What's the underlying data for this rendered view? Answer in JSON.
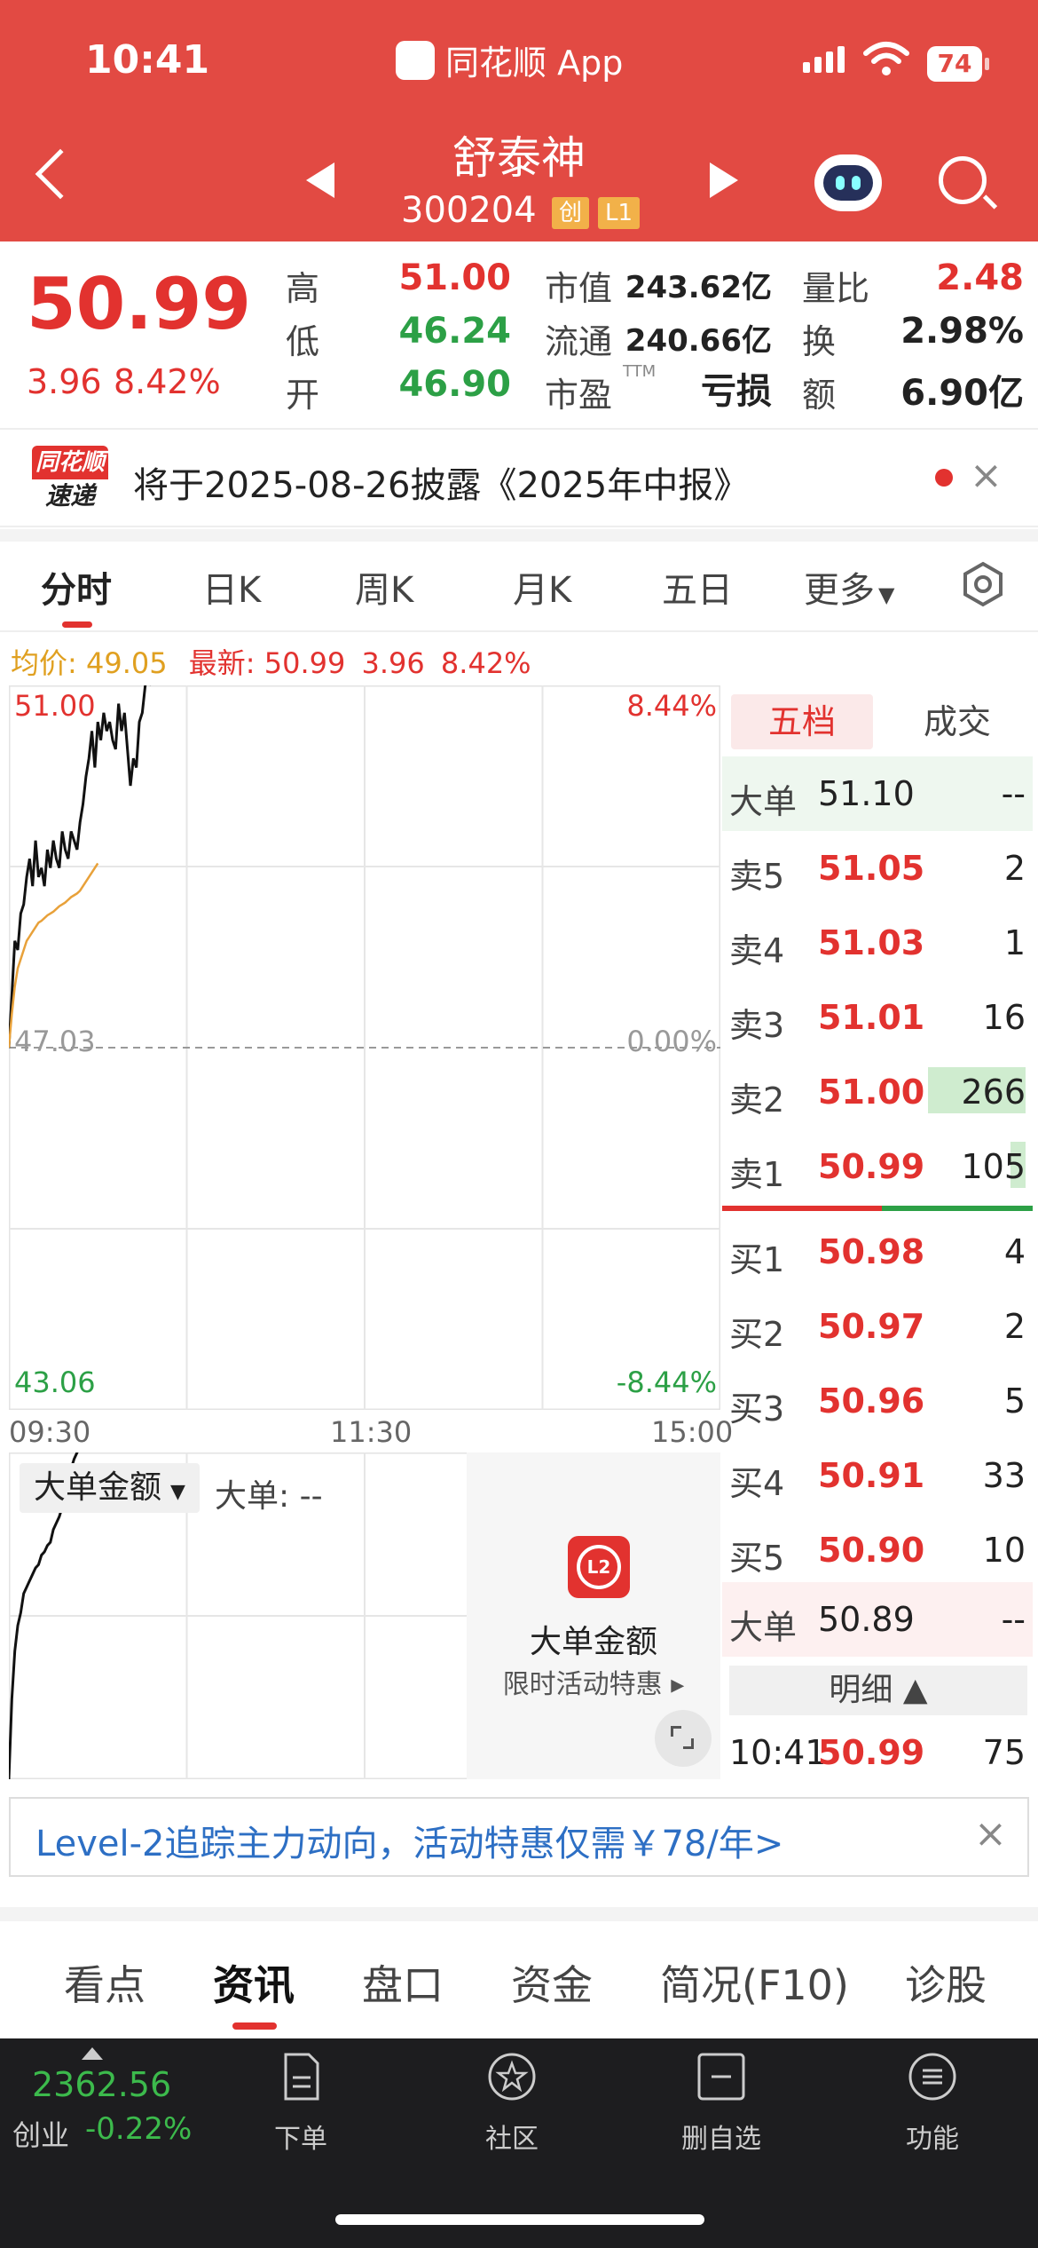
{
  "status_bar": {
    "time": "10:41",
    "app": "同花顺 App",
    "battery": "74"
  },
  "header": {
    "name": "舒泰神",
    "code": "300204",
    "badge_board": "创",
    "badge_level": "L1"
  },
  "quote": {
    "price": "50.99",
    "change": "3.96",
    "change_pct": "8.42%",
    "rows": [
      [
        {
          "label": "高",
          "value": "51.00",
          "color": "red"
        },
        {
          "label": "市值",
          "value": "243.62亿"
        },
        {
          "label": "量比",
          "value": "2.48",
          "color": "red"
        }
      ],
      [
        {
          "label": "低",
          "value": "46.24",
          "color": "green"
        },
        {
          "label": "流通",
          "value": "240.66亿"
        },
        {
          "label": "换",
          "value": "2.98%"
        }
      ],
      [
        {
          "label": "开",
          "value": "46.90",
          "color": "green"
        },
        {
          "label": "市盈",
          "sup": "TTM",
          "value": "亏损"
        },
        {
          "label": "额",
          "value": "6.90亿"
        }
      ]
    ]
  },
  "notice": {
    "logo_top": "同花顺",
    "logo_bottom": "速递",
    "text": "将于2025-08-26披露《2025年中报》",
    "close": "×"
  },
  "period_tabs": [
    "分时",
    "日K",
    "周K",
    "月K",
    "五日",
    "更多"
  ],
  "info_line": {
    "avg_label": "均价:",
    "avg_value": "49.05",
    "latest_label": "最新:",
    "latest_value": "50.99",
    "change": "3.96",
    "change_pct": "8.42%"
  },
  "chart_data": {
    "type": "line",
    "title": "",
    "x_ticks": [
      "09:30",
      "11:30",
      "15:00"
    ],
    "y_left_ticks": [
      "51.00",
      "47.03",
      "43.06"
    ],
    "y_right_ticks": [
      "8.44%",
      "0.00%",
      "-8.44%"
    ],
    "prev_close": 47.03,
    "ylim": [
      43.06,
      51.0
    ],
    "series": [
      {
        "values": [
          47.03,
          47.6,
          48.2,
          48.1,
          48.5,
          48.6,
          48.9,
          49.1,
          48.8,
          49.3,
          48.9,
          49.0,
          48.8,
          49.2,
          49.0,
          49.3,
          49.1,
          49.0,
          49.4,
          49.2,
          49.1,
          49.4,
          49.3,
          49.2,
          49.5,
          49.7,
          50.0,
          50.2,
          50.5,
          50.1,
          50.6,
          50.4,
          50.7,
          50.5,
          50.6,
          50.4,
          50.3,
          50.8,
          50.5,
          50.7,
          50.3,
          49.9,
          50.2,
          50.1,
          50.6,
          50.7,
          51.0,
          51.2,
          51.0
        ]
      },
      {
        "values": [
          47.03,
          47.4,
          47.7,
          47.9,
          48.0,
          48.1,
          48.2,
          48.25,
          48.3,
          48.35,
          48.4,
          48.42,
          48.45,
          48.48,
          48.5,
          48.52,
          48.55,
          48.58,
          48.6,
          48.62,
          48.65,
          48.68,
          48.7,
          48.72,
          48.75,
          48.8,
          48.85,
          48.9,
          48.95,
          49.0,
          49.05
        ]
      }
    ]
  },
  "volume_panel": {
    "selector": "大单金额",
    "label": "大单: --",
    "promo_title": "大单金额",
    "promo_sub": "限时活动特惠 ▸",
    "promo_icon": "L2"
  },
  "order_book": {
    "tabs": [
      "五档",
      "成交"
    ],
    "top_big": {
      "label": "大单",
      "price": "51.10",
      "vol": "--"
    },
    "asks": [
      {
        "label": "卖5",
        "price": "51.05",
        "vol": "2",
        "bar": 0
      },
      {
        "label": "卖4",
        "price": "51.03",
        "vol": "1",
        "bar": 0
      },
      {
        "label": "卖3",
        "price": "51.01",
        "vol": "16",
        "bar": 0
      },
      {
        "label": "卖2",
        "price": "51.00",
        "vol": "266",
        "bar": 1.0
      },
      {
        "label": "卖1",
        "price": "50.99",
        "vol": "105",
        "bar": 0.15
      }
    ],
    "bids": [
      {
        "label": "买1",
        "price": "50.98",
        "vol": "4"
      },
      {
        "label": "买2",
        "price": "50.97",
        "vol": "2"
      },
      {
        "label": "买3",
        "price": "50.96",
        "vol": "5"
      },
      {
        "label": "买4",
        "price": "50.91",
        "vol": "33"
      },
      {
        "label": "买5",
        "price": "50.90",
        "vol": "10"
      }
    ],
    "bottom_big": {
      "label": "大单",
      "price": "50.89",
      "vol": "--"
    },
    "detail_label": "明细 ▲",
    "last_trade": {
      "time": "10:41",
      "price": "50.99",
      "vol": "75"
    }
  },
  "promo_banner": {
    "text": "Level-2追踪主力动向，活动特惠仅需￥78/年>",
    "close": "×"
  },
  "bottom_tabs": [
    "看点",
    "资讯",
    "盘口",
    "资金",
    "简况(F10)",
    "诊股"
  ],
  "footer": {
    "index_value": "2362.56",
    "index_name": "创业",
    "index_change": "-0.22%",
    "buttons": [
      {
        "label": "下单",
        "icon": "order-icon"
      },
      {
        "label": "社区",
        "icon": "community-icon"
      },
      {
        "label": "删自选",
        "icon": "remove-watchlist-icon"
      },
      {
        "label": "功能",
        "icon": "menu-icon"
      }
    ]
  }
}
